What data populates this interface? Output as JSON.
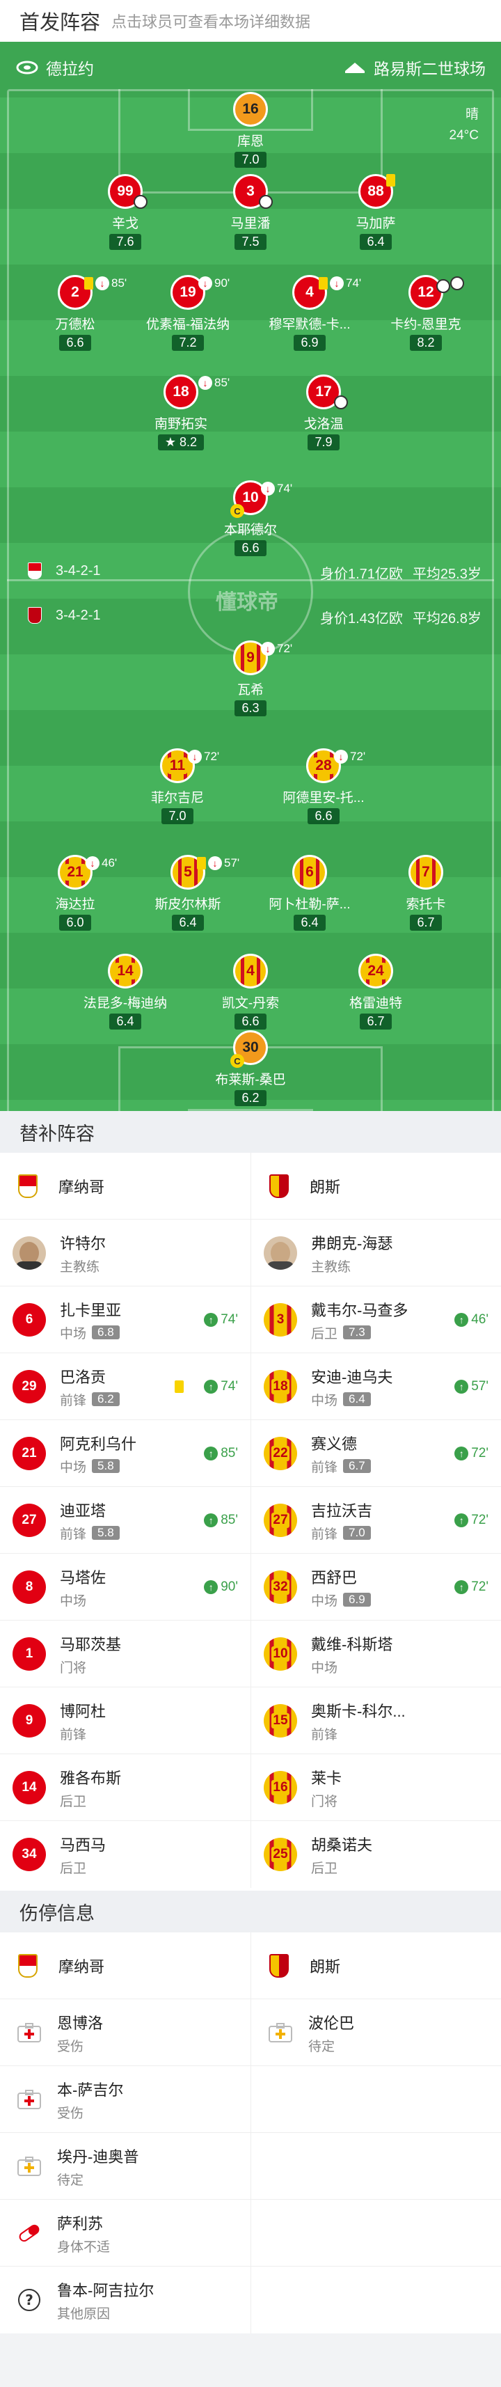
{
  "header": {
    "title": "首发阵容",
    "subtitle": "点击球员可查看本场详细数据"
  },
  "pitch": {
    "home_team": "德拉约",
    "stadium": "路易斯二世球场",
    "weather": "晴",
    "temperature": "24°C",
    "home_formation": "3-4-2-1",
    "home_value": "身价1.71亿欧",
    "home_age": "平均25.3岁",
    "away_formation": "3-4-2-1",
    "away_value": "身价1.43亿欧",
    "away_age": "平均26.8岁",
    "center_logo": "懂球帝"
  },
  "home_players": [
    {
      "number": "16",
      "name": "库恩",
      "rating": "7.0",
      "gk": true
    },
    {
      "number": "99",
      "name": "辛戈",
      "rating": "7.6"
    },
    {
      "number": "3",
      "name": "马里潘",
      "rating": "7.5"
    },
    {
      "number": "88",
      "name": "马加萨",
      "rating": "6.4"
    },
    {
      "number": "2",
      "name": "万德松",
      "rating": "6.6",
      "sub_minute": "85'"
    },
    {
      "number": "19",
      "name": "优素福-福法纳",
      "rating": "7.2",
      "sub_minute": "90'"
    },
    {
      "number": "4",
      "name": "穆罕默德-卡...",
      "rating": "6.9",
      "sub_minute": "74'"
    },
    {
      "number": "12",
      "name": "卡约-恩里克",
      "rating": "8.2"
    },
    {
      "number": "18",
      "name": "南野拓实",
      "rating": "8.2",
      "sub_minute": "85'"
    },
    {
      "number": "17",
      "name": "戈洛温",
      "rating": "7.9"
    },
    {
      "number": "10",
      "name": "本耶德尔",
      "rating": "6.6",
      "sub_minute": "74'"
    }
  ],
  "away_players": [
    {
      "number": "9",
      "name": "瓦希",
      "rating": "6.3",
      "sub_minute": "72'"
    },
    {
      "number": "11",
      "name": "菲尔吉尼",
      "rating": "7.0",
      "sub_minute": "72'"
    },
    {
      "number": "28",
      "name": "阿德里安-托...",
      "rating": "6.6",
      "sub_minute": "72'"
    },
    {
      "number": "21",
      "name": "海达拉",
      "rating": "6.0",
      "sub_minute": "46'"
    },
    {
      "number": "5",
      "name": "斯皮尔林斯",
      "rating": "6.4",
      "sub_minute": "57'"
    },
    {
      "number": "6",
      "name": "阿卜杜勒-萨...",
      "rating": "6.4"
    },
    {
      "number": "7",
      "name": "索托卡",
      "rating": "6.7"
    },
    {
      "number": "14",
      "name": "法昆多-梅迪纳",
      "rating": "6.4"
    },
    {
      "number": "4",
      "name": "凯文-丹索",
      "rating": "6.6"
    },
    {
      "number": "24",
      "name": "格雷迪特",
      "rating": "6.7"
    },
    {
      "number": "30",
      "name": "布莱斯-桑巴",
      "rating": "6.2",
      "gk": true
    }
  ],
  "subs_section": {
    "title": "替补阵容",
    "home_team": "摩纳哥",
    "away_team": "朗斯",
    "home_coach": {
      "name": "许特尔",
      "role": "主教练"
    },
    "away_coach": {
      "name": "弗朗克-海瑟",
      "role": "主教练"
    },
    "home_subs": [
      {
        "number": "6",
        "name": "扎卡里亚",
        "pos": "中场",
        "rating": "6.8",
        "minute": "74'"
      },
      {
        "number": "29",
        "name": "巴洛贡",
        "pos": "前锋",
        "rating": "6.2",
        "minute": "74'",
        "yellow": true
      },
      {
        "number": "21",
        "name": "阿克利乌什",
        "pos": "中场",
        "rating": "5.8",
        "minute": "85'"
      },
      {
        "number": "27",
        "name": "迪亚塔",
        "pos": "前锋",
        "rating": "5.8",
        "minute": "85'"
      },
      {
        "number": "8",
        "name": "马塔佐",
        "pos": "中场",
        "rating": "",
        "minute": "90'"
      },
      {
        "number": "1",
        "name": "马耶茨基",
        "pos": "门将",
        "rating": "",
        "minute": ""
      },
      {
        "number": "9",
        "name": "博阿杜",
        "pos": "前锋",
        "rating": "",
        "minute": ""
      },
      {
        "number": "14",
        "name": "雅各布斯",
        "pos": "后卫",
        "rating": "",
        "minute": ""
      },
      {
        "number": "34",
        "name": "马西马",
        "pos": "后卫",
        "rating": "",
        "minute": ""
      }
    ],
    "away_subs": [
      {
        "number": "3",
        "name": "戴韦尔-马查多",
        "pos": "后卫",
        "rating": "7.3",
        "minute": "46'"
      },
      {
        "number": "18",
        "name": "安迪-迪乌夫",
        "pos": "中场",
        "rating": "6.4",
        "minute": "57'"
      },
      {
        "number": "22",
        "name": "赛义德",
        "pos": "前锋",
        "rating": "6.7",
        "minute": "72'"
      },
      {
        "number": "27",
        "name": "吉拉沃吉",
        "pos": "前锋",
        "rating": "7.0",
        "minute": "72'"
      },
      {
        "number": "32",
        "name": "西舒巴",
        "pos": "中场",
        "rating": "6.9",
        "minute": "72'"
      },
      {
        "number": "10",
        "name": "戴维-科斯塔",
        "pos": "中场",
        "rating": "",
        "minute": ""
      },
      {
        "number": "15",
        "name": "奥斯卡-科尔...",
        "pos": "前锋",
        "rating": "",
        "minute": ""
      },
      {
        "number": "16",
        "name": "莱卡",
        "pos": "门将",
        "rating": "",
        "minute": ""
      },
      {
        "number": "25",
        "name": "胡桑诺夫",
        "pos": "后卫",
        "rating": "",
        "minute": ""
      }
    ]
  },
  "injury_section": {
    "title": "伤停信息",
    "home_team": "摩纳哥",
    "away_team": "朗斯",
    "home": [
      {
        "name": "恩博洛",
        "status": "受伤",
        "icon": "injury-cross-icon"
      },
      {
        "name": "本-萨吉尔",
        "status": "受伤",
        "icon": "injury-cross-icon"
      },
      {
        "name": "埃丹-迪奥普",
        "status": "待定",
        "icon": "doubtful-icon"
      },
      {
        "name": "萨利苏",
        "status": "身体不适",
        "icon": "pill-icon"
      },
      {
        "name": "鲁本-阿吉拉尔",
        "status": "其他原因",
        "icon": "question-icon"
      }
    ],
    "away": [
      {
        "name": "波伦巴",
        "status": "待定",
        "icon": "doubtful-icon"
      }
    ]
  },
  "colors": {
    "pitch": "#3da652",
    "home": "#e10012",
    "away": "#f6c400",
    "sub_in": "#3aa04a"
  }
}
